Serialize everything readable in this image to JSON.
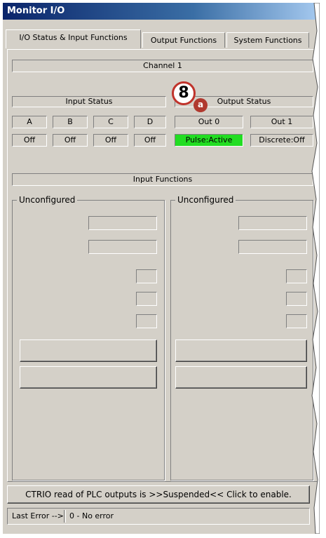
{
  "window": {
    "title": "Monitor I/O"
  },
  "tabs": [
    {
      "label": "I/O Status & Input Functions",
      "active": true
    },
    {
      "label": "Output Functions",
      "active": false
    },
    {
      "label": "System Functions",
      "active": false
    }
  ],
  "channel": {
    "label": "Channel 1"
  },
  "input_status": {
    "header": "Input Status",
    "inputs": [
      {
        "name": "A",
        "state": "Off"
      },
      {
        "name": "B",
        "state": "Off"
      },
      {
        "name": "C",
        "state": "Off"
      },
      {
        "name": "D",
        "state": "Off"
      }
    ]
  },
  "output_status": {
    "header": "Output Status",
    "outputs": [
      {
        "name": "Out 0",
        "state": "Pulse:Active",
        "color": "#22dd22"
      },
      {
        "name": "Out 1",
        "state": "Discrete:Off"
      }
    ]
  },
  "callout": {
    "number": "8",
    "letter": "a",
    "color": "#c0332b"
  },
  "input_functions": {
    "header": "Input Functions",
    "groups": [
      {
        "label": "Unconfigured"
      },
      {
        "label": "Unconfigured"
      }
    ]
  },
  "status_bar": {
    "suspend_message": "CTRIO read of PLC outputs is >>Suspended<< Click to enable.",
    "last_error_label": "Last Error -->",
    "last_error_value": "0 - No error"
  }
}
